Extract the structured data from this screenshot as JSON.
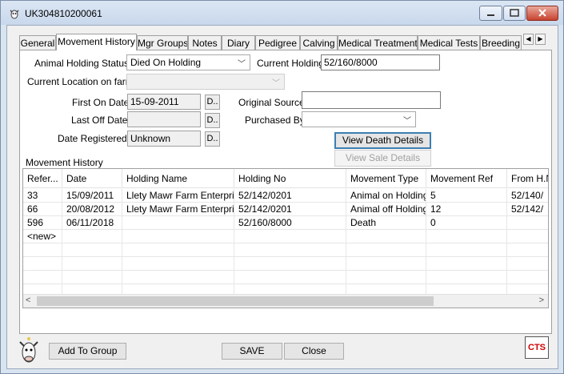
{
  "window": {
    "title": "UK304810200061"
  },
  "tabs": [
    {
      "label": "General"
    },
    {
      "label": "Movement History"
    },
    {
      "label": "Mgr Groups"
    },
    {
      "label": "Notes"
    },
    {
      "label": "Diary"
    },
    {
      "label": "Pedigree"
    },
    {
      "label": "Calving"
    },
    {
      "label": "Medical Treatment"
    },
    {
      "label": "Medical Tests"
    },
    {
      "label": "Breeding"
    }
  ],
  "form": {
    "animal_holding_status_label": "Animal Holding Status:",
    "animal_holding_status_value": "Died On Holding",
    "current_holding_label": "Current Holding:",
    "current_holding_value": "52/160/8000",
    "current_location_label": "Current Location on farm:",
    "current_location_value": "",
    "first_on_date_label": "First On Date:",
    "first_on_date_value": "15-09-2011",
    "original_source_label": "Original Source:",
    "original_source_value": "",
    "last_off_date_label": "Last Off Date:",
    "last_off_date_value": "",
    "purchased_by_label": "Purchased By:",
    "purchased_by_value": "",
    "date_registered_label": "Date Registered:",
    "date_registered_value": "Unknown",
    "dots_label": "D..",
    "view_death_details": "View Death Details",
    "view_sale_details": "View Sale Details"
  },
  "movement_history": {
    "label": "Movement History",
    "columns": [
      "Refer...",
      "Date",
      "Holding Name",
      "Holding No",
      "Movement Type",
      "Movement Ref",
      "From H.N"
    ],
    "rows": [
      [
        "33",
        "15/09/2011",
        "Llety Mawr Farm Enterpri",
        "52/142/0201",
        "Animal on Holding",
        "5",
        "52/140/"
      ],
      [
        "66",
        "20/08/2012",
        "Llety Mawr Farm Enterpri",
        "52/142/0201",
        "Animal off Holding",
        "12",
        "52/142/"
      ],
      [
        "596",
        "06/11/2018",
        "",
        "52/160/8000",
        "Death",
        "0",
        ""
      ],
      [
        "<new>",
        "",
        "",
        "",
        "",
        "",
        ""
      ],
      [
        "",
        "",
        "",
        "",
        "",
        "",
        ""
      ],
      [
        "",
        "",
        "",
        "",
        "",
        "",
        ""
      ],
      [
        "",
        "",
        "",
        "",
        "",
        "",
        ""
      ],
      [
        "",
        "",
        "",
        "",
        "",
        "",
        ""
      ]
    ]
  },
  "footer": {
    "add_to_group": "Add To Group",
    "save": "SAVE",
    "close": "Close",
    "logo_text": "CTS"
  }
}
